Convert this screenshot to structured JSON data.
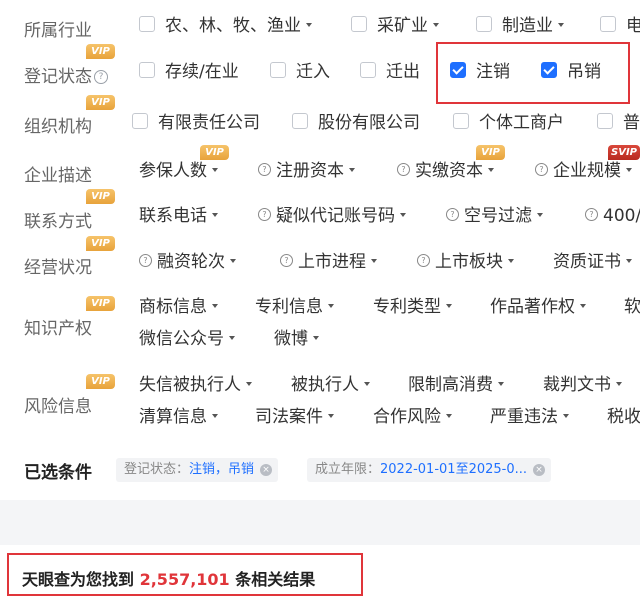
{
  "filters": {
    "industry": {
      "label": "所属行业",
      "options": [
        {
          "text": "农、林、牧、渔业",
          "dropdown": true
        },
        {
          "text": "采矿业",
          "dropdown": true
        },
        {
          "text": "制造业",
          "dropdown": true
        },
        {
          "text": "电",
          "dropdown": false
        }
      ]
    },
    "reg_status": {
      "label": "登记状态",
      "vip": "VIP",
      "options": [
        {
          "text": "存续/在业",
          "checked": false
        },
        {
          "text": "迁入",
          "checked": false
        },
        {
          "text": "迁出",
          "checked": false
        },
        {
          "text": "注销",
          "checked": true
        },
        {
          "text": "吊销",
          "checked": true
        }
      ]
    },
    "org": {
      "label": "组织机构",
      "vip": "VIP",
      "options": [
        {
          "text": "有限责任公司"
        },
        {
          "text": "股份有限公司"
        },
        {
          "text": "个体工商户"
        },
        {
          "text": "普"
        }
      ]
    },
    "desc": {
      "label": "企业描述",
      "options": [
        {
          "text": "参保人数",
          "vip": "VIP"
        },
        {
          "text": "注册资本"
        },
        {
          "text": "实缴资本",
          "vip": "VIP"
        },
        {
          "text": "企业规模",
          "vip": "SVIP"
        }
      ]
    },
    "contact": {
      "label": "联系方式",
      "vip": "VIP",
      "options": [
        {
          "text": "联系电话"
        },
        {
          "text": "疑似代记账号码"
        },
        {
          "text": "空号过滤"
        },
        {
          "text": "400/"
        }
      ]
    },
    "operation": {
      "label": "经营状况",
      "vip": "VIP",
      "options": [
        {
          "text": "融资轮次"
        },
        {
          "text": "上市进程"
        },
        {
          "text": "上市板块"
        },
        {
          "text": "资质证书"
        }
      ]
    },
    "ip": {
      "label": "知识产权",
      "vip": "VIP",
      "row1": [
        "商标信息",
        "专利信息",
        "专利类型",
        "作品著作权",
        "软"
      ],
      "row2": [
        "微信公众号",
        "微博"
      ]
    },
    "risk": {
      "label": "风险信息",
      "vip": "VIP",
      "row1": [
        "失信被执行人",
        "被执行人",
        "限制高消费",
        "裁判文书"
      ],
      "row2": [
        "清算信息",
        "司法案件",
        "合作风险",
        "严重违法",
        "税收"
      ]
    }
  },
  "selected": {
    "label": "已选条件",
    "tags": [
      {
        "key": "登记状态：",
        "value": "注销，吊销",
        "close": "×"
      },
      {
        "key": "成立年限：",
        "value": "2022-01-01至2025-0...",
        "close": "×"
      }
    ]
  },
  "result": {
    "prefix": "天眼查为您找到",
    "count": "2,557,101",
    "suffix": "条相关结果"
  },
  "icons": {
    "help": "?",
    "check": "checkmark-icon",
    "caret": "caret-down-icon"
  },
  "colors": {
    "accent": "#1e6fff",
    "highlight_box": "#e0353a",
    "vip": "#e8a33b",
    "svip": "#b92a20"
  }
}
